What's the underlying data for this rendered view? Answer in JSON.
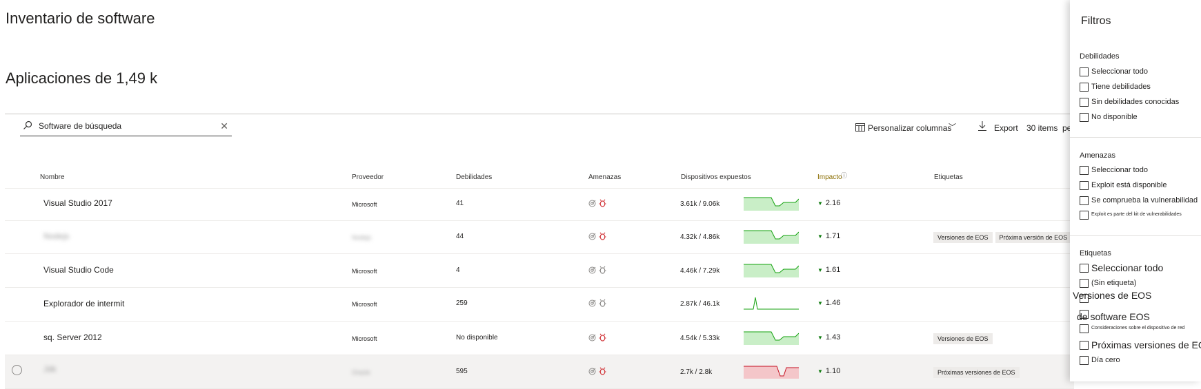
{
  "page": {
    "title": "Inventario de software",
    "subtitle": "Aplicaciones de 1,49 k"
  },
  "search": {
    "value": "Software de búsqueda",
    "icon": "search-icon"
  },
  "toolbar": {
    "customize_label": "Personalizar columnas",
    "export_label": "Export",
    "items_label": "30 items",
    "items_cut": "pe"
  },
  "columns": [
    "Nombre",
    "Proveedor",
    "Debilidades",
    "Amenazas",
    "Dispositivos expuestos",
    "Impacto",
    "Etiquetas"
  ],
  "rows": [
    {
      "name": "Visual Studio 2017",
      "vendor": "Microsoft",
      "weaknesses": "41",
      "devices": "3.61k / 9.06k",
      "impact": "2.16",
      "trend": "green",
      "tags": []
    },
    {
      "name": "Nodejs",
      "vendor": "Nodejs",
      "weaknesses": "44",
      "devices": "4.32k / 4.86k",
      "impact": "1.71",
      "trend": "green",
      "tags": [
        "Versiones de EOS",
        "Próxima versión de EOS"
      ],
      "tag_overflow": "n"
    },
    {
      "name": "Visual Studio Code",
      "vendor": "Microsoft",
      "weaknesses": "4",
      "devices": "4.46k / 7.29k",
      "impact": "1.61",
      "trend": "green",
      "tags": []
    },
    {
      "name": "Explorador de intermit",
      "vendor": "Microsoft",
      "weaknesses": "259",
      "devices": "2.87k / 46.1k",
      "impact": "1.46",
      "trend": "spike",
      "tags": []
    },
    {
      "name": "sq. Server 2012",
      "vendor": "Microsoft",
      "weaknesses": "No disponible",
      "devices": "4.54k / 5.33k",
      "impact": "1.43",
      "trend": "green",
      "tags": [
        "Versiones de EOS"
      ]
    },
    {
      "name": "Jdk",
      "vendor": "Oracle",
      "weaknesses": "595",
      "devices": "2.7k / 2.8k",
      "impact": "1.10",
      "trend": "red",
      "tags": [
        "Próximas versiones de EOS"
      ]
    }
  ],
  "filters": {
    "title": "Filtros",
    "weaknesses": {
      "label": "Debilidades",
      "options": [
        "Seleccionar todo",
        "Tiene debilidades",
        "Sin debilidades conocidas",
        "No disponible"
      ]
    },
    "threats": {
      "label": "Amenazas",
      "options": [
        "Seleccionar todo",
        "Exploit está disponible",
        "Se comprueba la vulnerabilidad",
        "Exploit es parte del kit de vulnerabilidades"
      ]
    },
    "tags": {
      "label": "Etiquetas",
      "options": [
        "Seleccionar todo",
        "(Sin etiqueta)",
        "Versiones de EOS",
        "de software EOS",
        "Consideraciones sobre el dispositivo de red",
        "Próximas versiones de EOS",
        "Día cero"
      ]
    }
  },
  "colors": {
    "impact_label": "#8a6d00",
    "trend_green": "#13a10e",
    "trend_green_fill": "#c9eec7",
    "trend_red": "#c50f1f",
    "trend_red_fill": "#f4c6c9",
    "threat_red": "#d13438"
  }
}
